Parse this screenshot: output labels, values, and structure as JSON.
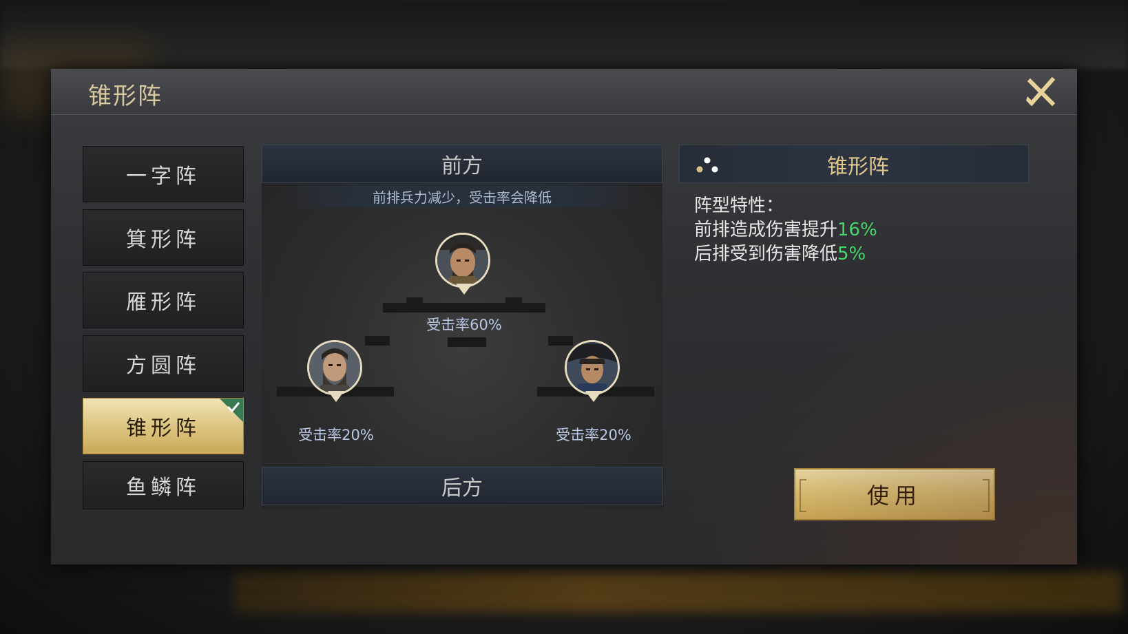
{
  "modal": {
    "title": "锥形阵"
  },
  "formations": [
    {
      "label": "一字阵",
      "active": false
    },
    {
      "label": "箕形阵",
      "active": false
    },
    {
      "label": "雁形阵",
      "active": false
    },
    {
      "label": "方圆阵",
      "active": false
    },
    {
      "label": "锥形阵",
      "active": true
    },
    {
      "label": "鱼鳞阵",
      "active": false
    }
  ],
  "center": {
    "front_label": "前方",
    "back_label": "后方",
    "subtitle": "前排兵力减少，受击率会降低",
    "heroes": [
      {
        "position": "front",
        "hit_rate": "受击率60%"
      },
      {
        "position": "back-left",
        "hit_rate": "受击率20%"
      },
      {
        "position": "back-right",
        "hit_rate": "受击率20%"
      }
    ]
  },
  "detail": {
    "title": "锥形阵",
    "traits_heading": "阵型特性：",
    "trait_1_text": "前排造成伤害提升",
    "trait_1_value": "16%",
    "trait_2_text": "后排受到伤害降低",
    "trait_2_value": "5%",
    "use_button": "使用"
  },
  "colors": {
    "accent_gold": "#e0c88a",
    "positive_green": "#47d86a",
    "hit_rate_blue": "#b8c8e6"
  }
}
